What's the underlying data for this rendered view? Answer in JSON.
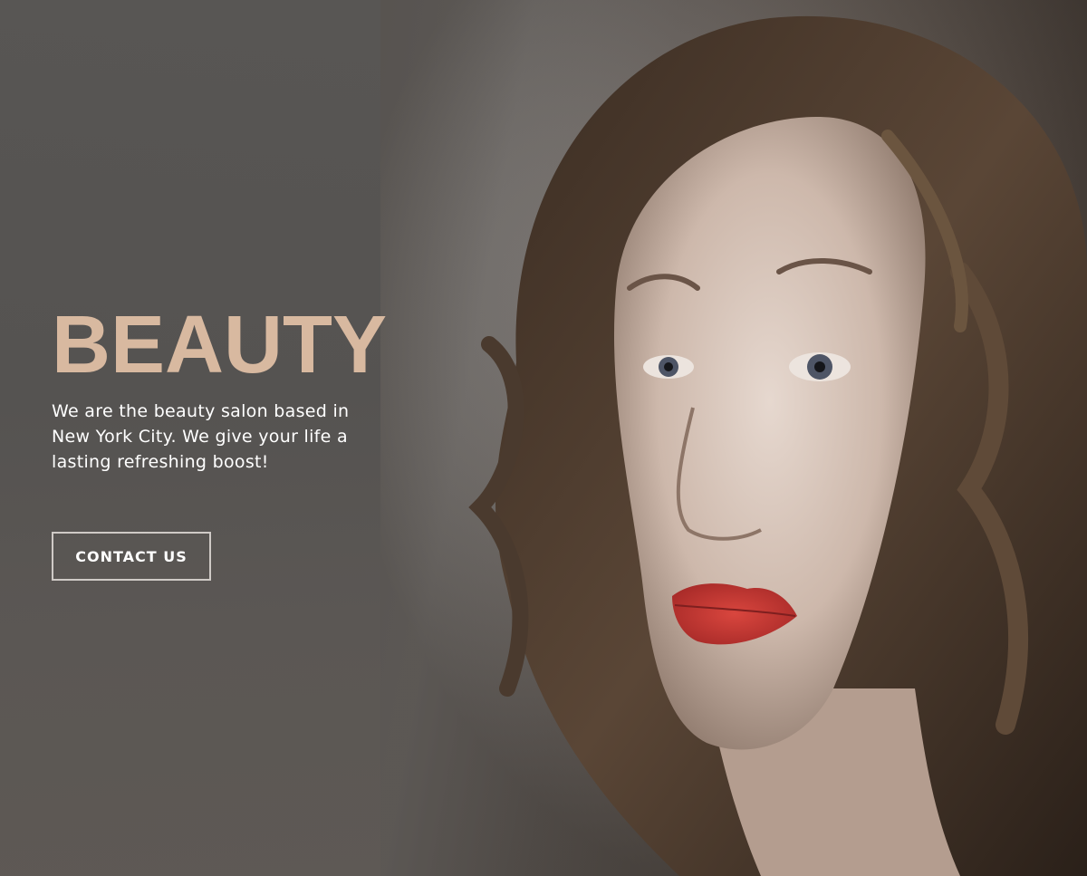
{
  "hero": {
    "title": "BEAUTY",
    "description": "We are the beauty salon based in New York City. We give your life a lasting refreshing boost!",
    "cta_label": "CONTACT US"
  },
  "colors": {
    "title": "#d8b9a0",
    "panel": "#565452",
    "text": "#ffffff"
  }
}
